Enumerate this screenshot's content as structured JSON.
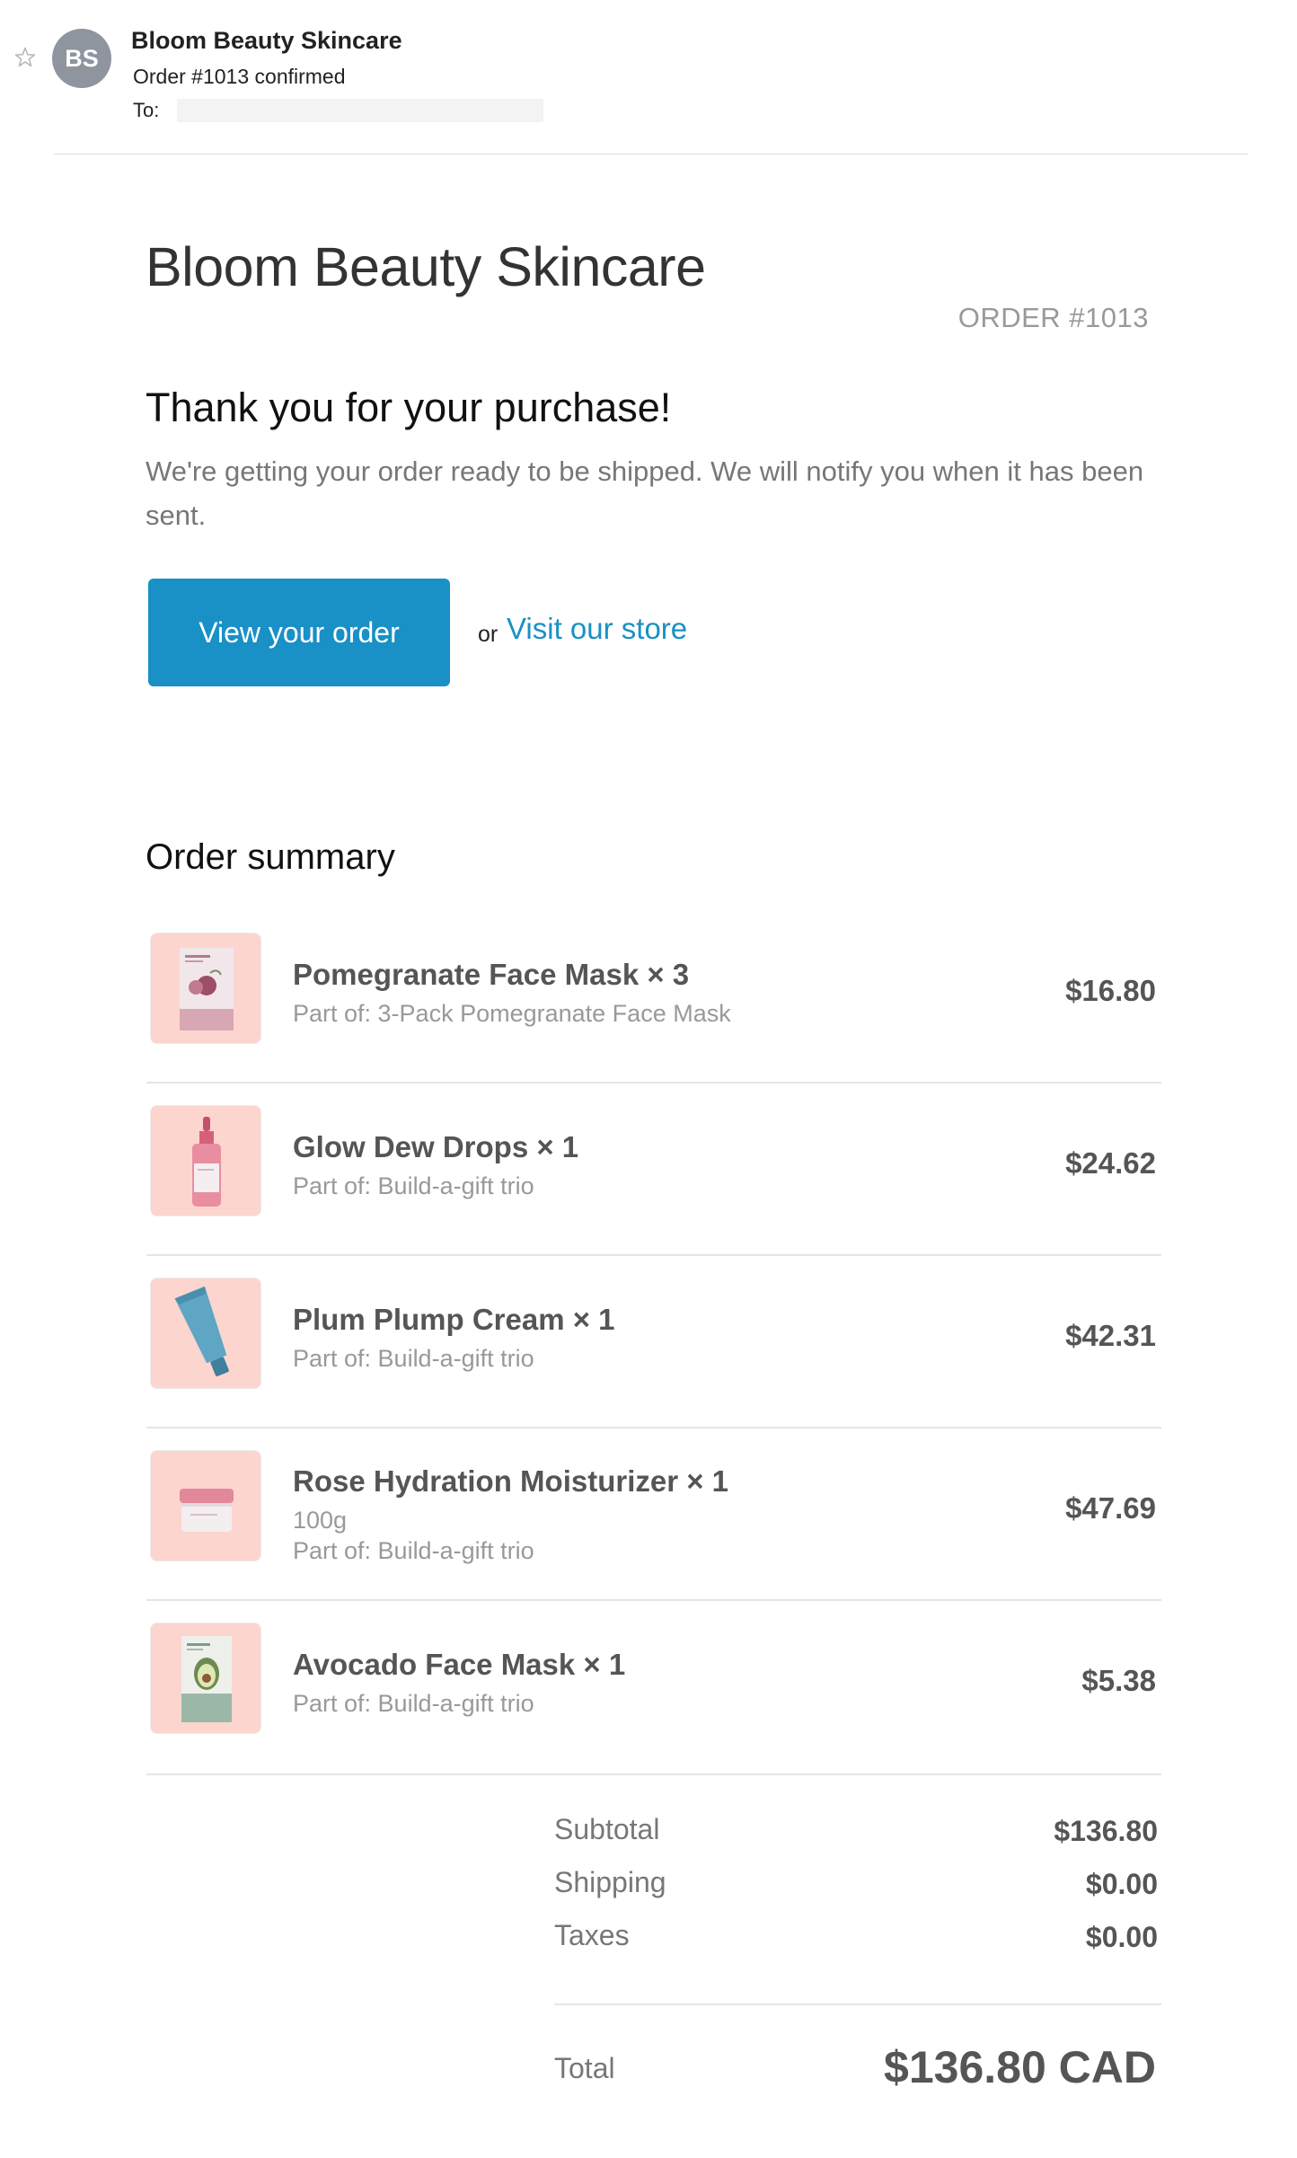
{
  "email": {
    "avatar_initials": "BS",
    "sender": "Bloom Beauty Skincare",
    "subject": "Order #1013 confirmed",
    "to_label": "To:"
  },
  "body": {
    "shop_name": "Bloom Beauty Skincare",
    "order_number": "ORDER #1013",
    "thanks_heading": "Thank you for your purchase!",
    "thanks_text": "We're getting your order ready to be shipped. We will notify you when it has been sent.",
    "view_order_label": "View your order",
    "or_text": "or",
    "visit_store_label": "Visit our store",
    "summary_heading": "Order summary"
  },
  "items": [
    {
      "name": "Pomegranate Face Mask × 3",
      "variant": "",
      "part_of": "Part of: 3-Pack Pomegranate Face Mask",
      "price": "$16.80",
      "icon": "pomegranate-mask-icon"
    },
    {
      "name": "Glow Dew Drops × 1",
      "variant": "",
      "part_of": "Part of: Build-a-gift trio",
      "price": "$24.62",
      "icon": "dropper-bottle-icon"
    },
    {
      "name": "Plum Plump Cream × 1",
      "variant": "",
      "part_of": "Part of: Build-a-gift trio",
      "price": "$42.31",
      "icon": "cream-tube-icon"
    },
    {
      "name": "Rose Hydration Moisturizer × 1",
      "variant": "100g",
      "part_of": "Part of: Build-a-gift trio",
      "price": "$47.69",
      "icon": "cream-jar-icon"
    },
    {
      "name": "Avocado Face Mask × 1",
      "variant": "",
      "part_of": "Part of: Build-a-gift trio",
      "price": "$5.38",
      "icon": "avocado-mask-icon"
    }
  ],
  "totals": {
    "subtotal_label": "Subtotal",
    "subtotal": "$136.80",
    "shipping_label": "Shipping",
    "shipping": "$0.00",
    "taxes_label": "Taxes",
    "taxes": "$0.00",
    "total_label": "Total",
    "total": "$136.80 CAD"
  },
  "colors": {
    "accent": "#1990c6",
    "thumb_background": "#fcd5cf",
    "avatar": "#8e959e"
  }
}
